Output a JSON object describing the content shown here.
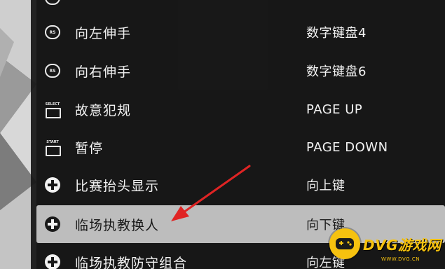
{
  "rows": [
    {
      "label": "",
      "key": "",
      "icon": "stick-icon",
      "icon_text": ""
    },
    {
      "label": "向左伸手",
      "key": "数字键盘4",
      "icon": "rs-stick-icon",
      "icon_text": "RS"
    },
    {
      "label": "向右伸手",
      "key": "数字键盘6",
      "icon": "rs-stick-icon",
      "icon_text": "RS"
    },
    {
      "label": "故意犯规",
      "key": "PAGE UP",
      "icon": "select-button-icon",
      "icon_text": "SELECT"
    },
    {
      "label": "暂停",
      "key": "PAGE DOWN",
      "icon": "start-button-icon",
      "icon_text": "START"
    },
    {
      "label": "比赛抬头显示",
      "key": "向上键",
      "icon": "dpad-icon",
      "icon_text": ""
    },
    {
      "label": "临场执教换人",
      "key": "向下键",
      "icon": "dpad-icon",
      "icon_text": ""
    },
    {
      "label": "临场执教防守组合",
      "key": "向左键",
      "icon": "dpad-icon",
      "icon_text": ""
    }
  ],
  "selected_row": "临场执教换人",
  "watermark": {
    "text": "DVG游戏网",
    "url": "WWW.DVG.CN"
  },
  "colors": {
    "panel": "#161616",
    "selected_row": "#bdbdbd",
    "arrow": "#e02424",
    "watermark": "#f6c20f"
  }
}
